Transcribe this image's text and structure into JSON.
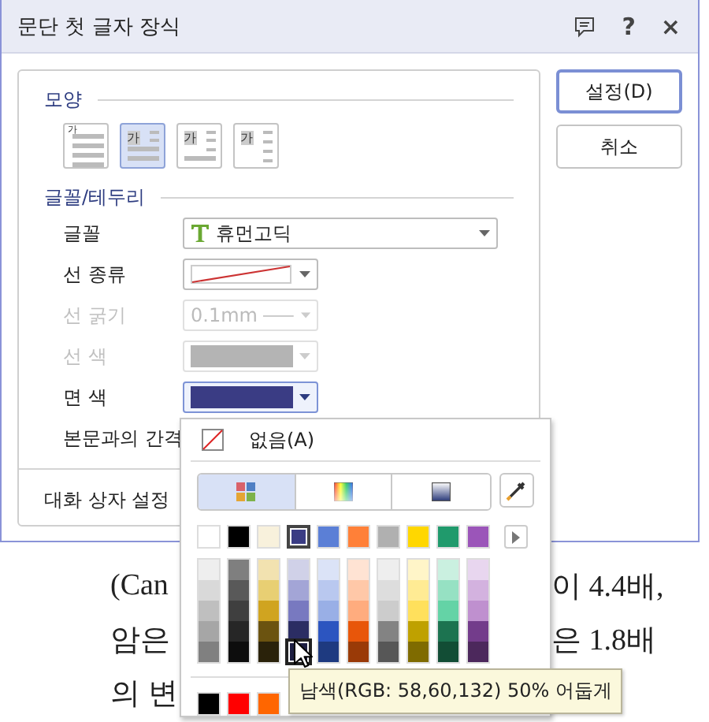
{
  "window": {
    "title": "문단 첫 글자 장식",
    "help": "?",
    "close": "×"
  },
  "shape": {
    "heading": "모양",
    "options": [
      {
        "kind": "none",
        "glyph": "가",
        "selected": false
      },
      {
        "kind": "two-line",
        "glyph": "가",
        "selected": true
      },
      {
        "kind": "three-line",
        "glyph": "가",
        "selected": false
      },
      {
        "kind": "margin",
        "glyph": "가",
        "selected": false
      }
    ]
  },
  "font_border": {
    "heading": "글꼴/테두리",
    "rows": [
      {
        "kind": "font",
        "label": "글꼴",
        "value": "휴먼고딕",
        "disabled": false
      },
      {
        "kind": "line-type",
        "label": "선 종류",
        "disabled": false
      },
      {
        "kind": "line-width",
        "label": "선 굵기",
        "value": "0.1mm",
        "disabled": true
      },
      {
        "kind": "line-color",
        "label": "선 색",
        "color": "#b4b4b4",
        "disabled": true
      },
      {
        "kind": "fill-color",
        "label": "면 색",
        "color": "#3a3c84",
        "disabled": false,
        "expanded": true
      },
      {
        "kind": "spacing",
        "label": "본문과의 간격",
        "disabled": false
      }
    ]
  },
  "dialog_settings": {
    "label": "대화 상자 설정"
  },
  "buttons": [
    {
      "label": "설정(D)",
      "default": true
    },
    {
      "label": "취소",
      "default": false
    }
  ],
  "color_popup": {
    "none_label": "없음(A)",
    "tabs": [
      {
        "kind": "swatches",
        "selected": true
      },
      {
        "kind": "spectrum",
        "selected": false
      },
      {
        "kind": "gradient",
        "selected": false
      }
    ],
    "theme_colors": [
      {
        "color": "#ffffff",
        "selected": false
      },
      {
        "color": "#000000",
        "selected": false
      },
      {
        "color": "#f8f1dc",
        "selected": false
      },
      {
        "color": "#3a3c84",
        "selected": true
      },
      {
        "color": "#5b7fd6",
        "selected": false
      },
      {
        "color": "#ff8038",
        "selected": false
      },
      {
        "color": "#b0b0b0",
        "selected": false
      },
      {
        "color": "#ffd700",
        "selected": false
      },
      {
        "color": "#209a6c",
        "selected": false
      },
      {
        "color": "#9b55b9",
        "selected": false
      }
    ],
    "shade_columns": [
      {
        "shades": [
          {
            "color": "#eeeeee",
            "hovered": false
          },
          {
            "color": "#d9d9d9",
            "hovered": false
          },
          {
            "color": "#bfbfbf",
            "hovered": false
          },
          {
            "color": "#a6a6a6",
            "hovered": false
          },
          {
            "color": "#808080",
            "hovered": false
          }
        ]
      },
      {
        "shades": [
          {
            "color": "#7f7f7f",
            "hovered": false
          },
          {
            "color": "#595959",
            "hovered": false
          },
          {
            "color": "#3f3f3f",
            "hovered": false
          },
          {
            "color": "#262626",
            "hovered": false
          },
          {
            "color": "#0d0d0d",
            "hovered": false
          }
        ]
      },
      {
        "shades": [
          {
            "color": "#f2e2b0",
            "hovered": false
          },
          {
            "color": "#e8cf73",
            "hovered": false
          },
          {
            "color": "#d0a420",
            "hovered": false
          },
          {
            "color": "#6b5310",
            "hovered": false
          },
          {
            "color": "#2a220a",
            "hovered": false
          }
        ]
      },
      {
        "shades": [
          {
            "color": "#d0d1e8",
            "hovered": false
          },
          {
            "color": "#a3a5d6",
            "hovered": false
          },
          {
            "color": "#7879c0",
            "hovered": false
          },
          {
            "color": "#2b2d63",
            "hovered": false
          },
          {
            "color": "#1d1e42",
            "hovered": true
          }
        ]
      },
      {
        "shades": [
          {
            "color": "#dbe3f7",
            "hovered": false
          },
          {
            "color": "#b9c8ef",
            "hovered": false
          },
          {
            "color": "#99afe6",
            "hovered": false
          },
          {
            "color": "#2c55c0",
            "hovered": false
          },
          {
            "color": "#1e3a80",
            "hovered": false
          }
        ]
      },
      {
        "shades": [
          {
            "color": "#ffe3d3",
            "hovered": false
          },
          {
            "color": "#ffc8a8",
            "hovered": false
          },
          {
            "color": "#ffac7e",
            "hovered": false
          },
          {
            "color": "#e8560a",
            "hovered": false
          },
          {
            "color": "#9a3a07",
            "hovered": false
          }
        ]
      },
      {
        "shades": [
          {
            "color": "#eeeeee",
            "hovered": false
          },
          {
            "color": "#dddddd",
            "hovered": false
          },
          {
            "color": "#cccccc",
            "hovered": false
          },
          {
            "color": "#838383",
            "hovered": false
          },
          {
            "color": "#575757",
            "hovered": false
          }
        ]
      },
      {
        "shades": [
          {
            "color": "#fff5c8",
            "hovered": false
          },
          {
            "color": "#ffeb94",
            "hovered": false
          },
          {
            "color": "#ffe05c",
            "hovered": false
          },
          {
            "color": "#bfa100",
            "hovered": false
          },
          {
            "color": "#7f6b00",
            "hovered": false
          }
        ]
      },
      {
        "shades": [
          {
            "color": "#caf0e0",
            "hovered": false
          },
          {
            "color": "#96e1c3",
            "hovered": false
          },
          {
            "color": "#64d3a6",
            "hovered": false
          },
          {
            "color": "#1c7350",
            "hovered": false
          },
          {
            "color": "#124d35",
            "hovered": false
          }
        ]
      },
      {
        "shades": [
          {
            "color": "#e8d6ef",
            "hovered": false
          },
          {
            "color": "#d3b2df",
            "hovered": false
          },
          {
            "color": "#bf90cf",
            "hovered": false
          },
          {
            "color": "#733c8b",
            "hovered": false
          },
          {
            "color": "#4c285c",
            "hovered": false
          }
        ]
      }
    ],
    "recent_colors": [
      {
        "color": "#000000"
      },
      {
        "color": "#ff0000"
      },
      {
        "color": "#ff6600"
      }
    ],
    "tooltip": "남색(RGB: 58,60,132) 50% 어둡게"
  },
  "document": {
    "lines": [
      {
        "left": "(Can",
        "right": "이 4.4배,"
      },
      {
        "left": "암은",
        "right": "은 1.8배"
      },
      {
        "left": "의 변"
      }
    ]
  }
}
